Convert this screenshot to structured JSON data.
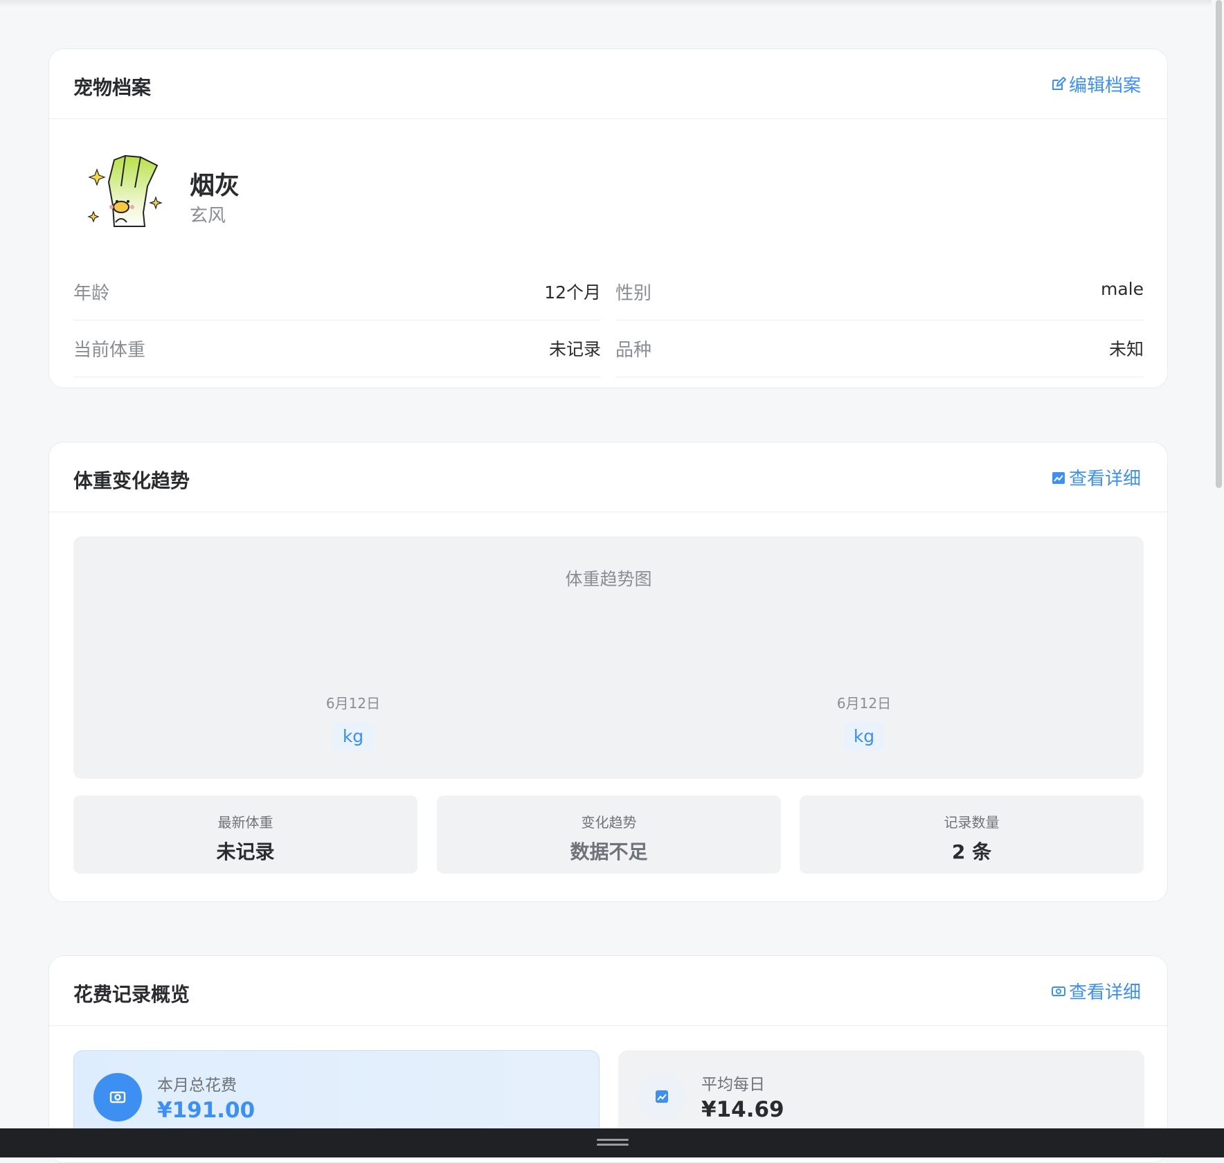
{
  "profile": {
    "title": "宠物档案",
    "edit_label": "编辑档案",
    "pet_name": "烟灰",
    "pet_sub": "玄风",
    "fields": [
      {
        "label": "年龄",
        "value": "12个月"
      },
      {
        "label": "性别",
        "value": "male"
      },
      {
        "label": "当前体重",
        "value": "未记录"
      },
      {
        "label": "品种",
        "value": "未知"
      }
    ]
  },
  "weight": {
    "title": "体重变化趋势",
    "detail_label": "查看详细",
    "chart_title": "体重趋势图",
    "points": [
      {
        "date": "6月12日",
        "unit": "kg"
      },
      {
        "date": "6月12日",
        "unit": "kg"
      }
    ],
    "stats": [
      {
        "label": "最新体重",
        "value": "未记录"
      },
      {
        "label": "变化趋势",
        "value": "数据不足"
      },
      {
        "label": "记录数量",
        "value": "2 条"
      }
    ]
  },
  "expense": {
    "title": "花费记录概览",
    "detail_label": "查看详细",
    "month_total_label": "本月总花费",
    "month_total_value": "¥191.00",
    "daily_avg_label": "平均每日",
    "daily_avg_value": "¥14.69"
  },
  "icons": {
    "edit": "edit-icon",
    "chart": "trend-chart-icon",
    "money": "money-icon",
    "avatar": "leek-character-avatar"
  },
  "colors": {
    "accent": "#3d8ff2",
    "background": "#f6f7f9"
  }
}
